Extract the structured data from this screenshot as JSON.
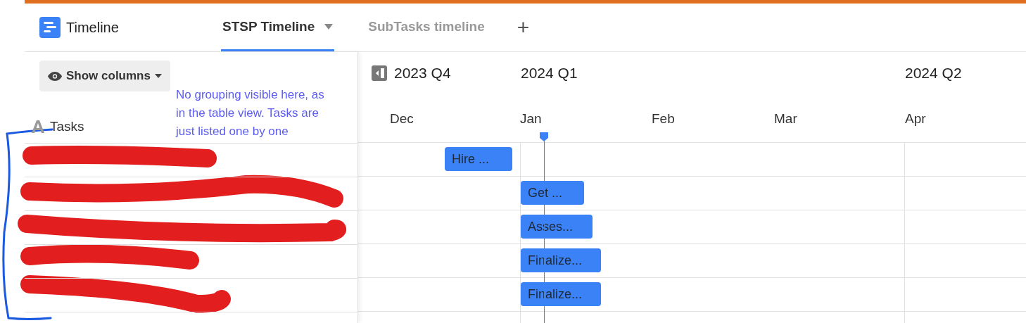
{
  "app": {
    "title": "Timeline"
  },
  "tabs": [
    {
      "label": "STSP Timeline",
      "selected": true,
      "has_menu": true
    },
    {
      "label": "SubTasks timeline",
      "selected": false,
      "has_menu": false
    }
  ],
  "add_tab": "+",
  "toolbar": {
    "show_columns": "Show columns"
  },
  "columns": {
    "tasks": "Tasks"
  },
  "annotation": "No grouping visible here, as in the table view. Tasks are just listed one by one",
  "quarters": [
    "2023 Q4",
    "2024 Q1",
    "2024 Q2"
  ],
  "months": [
    "Dec",
    "Jan",
    "Feb",
    "Mar",
    "Apr"
  ],
  "rows": [
    {
      "bar": "Hire ..."
    },
    {
      "bar": "Get ..."
    },
    {
      "bar": "Asses..."
    },
    {
      "bar": "Finalize..."
    },
    {
      "bar": "Finalize..."
    }
  ]
}
